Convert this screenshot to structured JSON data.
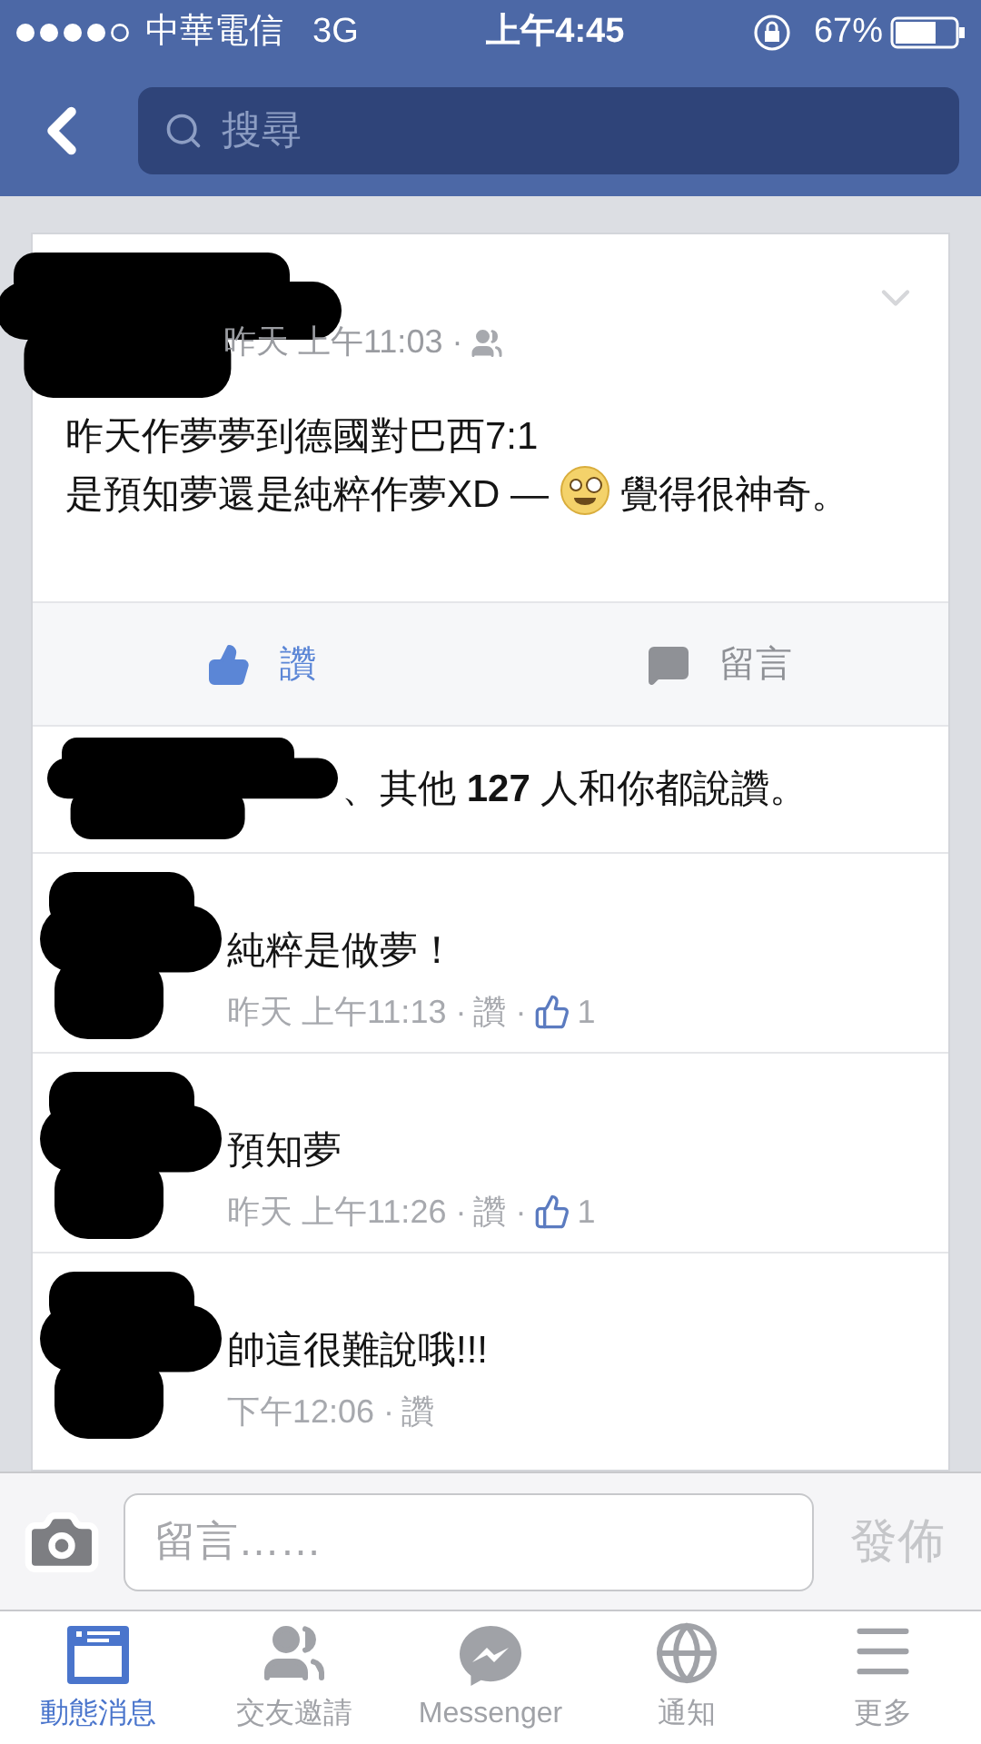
{
  "status_bar": {
    "carrier": "中華電信",
    "network": "3G",
    "time": "上午4:45",
    "battery": "67%"
  },
  "nav": {
    "search": {
      "placeholder": "搜尋"
    }
  },
  "post": {
    "timestamp": "昨天 上午11:03 ·",
    "lines": [
      "昨天作夢夢到德國對巴西7:1",
      "是預知夢還是純粹作夢XD —"
    ],
    "feeling": "覺得很神奇。",
    "actions": [
      {
        "kind": "like",
        "label": "讚",
        "selected": true
      },
      {
        "kind": "comment",
        "label": "留言",
        "selected": false
      }
    ],
    "likes_summary": "、其他 **127** 人和你都說讚。"
  },
  "comments": [
    {
      "text": "純粹是做夢！",
      "time": "昨天 上午11:13 ·",
      "like_label": "讚 ·",
      "like_count": "1"
    },
    {
      "text": "預知夢",
      "time": "昨天 上午11:26 ·",
      "like_label": "讚 ·",
      "like_count": "1"
    },
    {
      "text": "帥這很難說哦!!!",
      "time": "下午12:06 ·",
      "like_label": "讚"
    }
  ],
  "composer": {
    "placeholder": "留言……",
    "send": "發佈"
  },
  "tabs": [
    {
      "kind": "feed",
      "label": "動態消息",
      "selected": true
    },
    {
      "kind": "friends",
      "label": "交友邀請",
      "selected": false
    },
    {
      "kind": "messenger",
      "label": "Messenger",
      "selected": false
    },
    {
      "kind": "globe",
      "label": "通知",
      "selected": false
    },
    {
      "kind": "menu",
      "label": "更多",
      "selected": false
    }
  ]
}
